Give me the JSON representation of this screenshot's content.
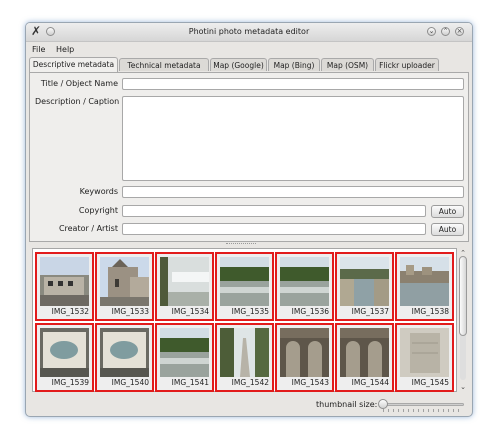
{
  "window": {
    "title": "Photini photo metadata editor"
  },
  "menu": [
    "File",
    "Help"
  ],
  "tabs": [
    "Descriptive metadata",
    "Technical metadata",
    "Map (Google)",
    "Map (Bing)",
    "Map (OSM)",
    "Flickr uploader"
  ],
  "active_tab": 0,
  "form": {
    "title_label": "Title / Object Name",
    "description_label": "Description / Caption",
    "keywords_label": "Keywords",
    "copyright_label": "Copyright",
    "creator_label": "Creator / Artist",
    "auto_label": "Auto"
  },
  "thumbnails": [
    {
      "name": "IMG_1532",
      "scene": "building"
    },
    {
      "name": "IMG_1533",
      "scene": "church"
    },
    {
      "name": "IMG_1534",
      "scene": "weir"
    },
    {
      "name": "IMG_1535",
      "scene": "river-trees"
    },
    {
      "name": "IMG_1536",
      "scene": "river-trees"
    },
    {
      "name": "IMG_1537",
      "scene": "canal"
    },
    {
      "name": "IMG_1538",
      "scene": "riverside-town"
    },
    {
      "name": "IMG_1539",
      "scene": "map-sign"
    },
    {
      "name": "IMG_1540",
      "scene": "map-sign"
    },
    {
      "name": "IMG_1541",
      "scene": "river-trees"
    },
    {
      "name": "IMG_1542",
      "scene": "path"
    },
    {
      "name": "IMG_1543",
      "scene": "arches"
    },
    {
      "name": "IMG_1544",
      "scene": "arches"
    },
    {
      "name": "IMG_1545",
      "scene": "stone"
    }
  ],
  "footer": {
    "thumbnail_size_label": "thumbnail size:"
  }
}
